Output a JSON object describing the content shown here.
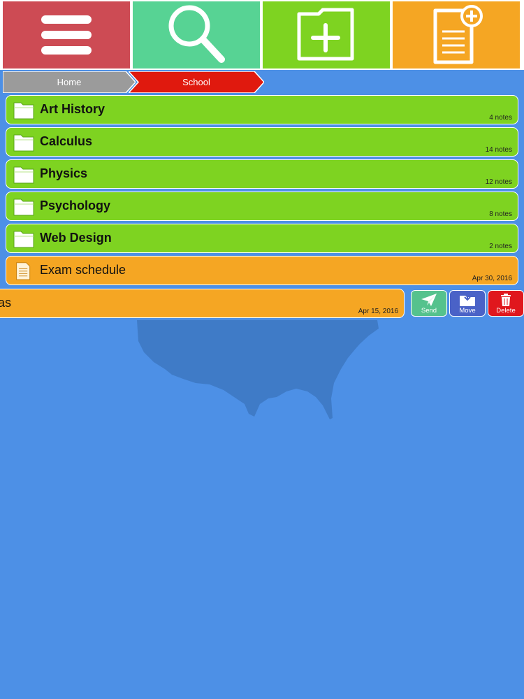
{
  "colors": {
    "background": "#4d90e6",
    "menu_button": "#cd4b54",
    "search_button": "#57d394",
    "new_folder_button": "#7ed321",
    "new_note_button": "#f5a623",
    "breadcrumb_home": "#9b9b9b",
    "breadcrumb_current": "#e0190e",
    "folder_row": "#7ed321",
    "note_row": "#f5a623",
    "send": "#55c28d",
    "move": "#4a62c7",
    "delete": "#e0171d"
  },
  "toolbar": {
    "menu_icon": "hamburger-icon",
    "search_icon": "magnifier-icon",
    "new_folder_icon": "folder-plus-icon",
    "new_note_icon": "note-plus-icon"
  },
  "breadcrumb": {
    "items": [
      {
        "label": "Home"
      },
      {
        "label": "School"
      }
    ]
  },
  "folders": [
    {
      "title": "Art History",
      "count": "4 notes"
    },
    {
      "title": "Calculus",
      "count": "14 notes"
    },
    {
      "title": "Physics",
      "count": "12 notes"
    },
    {
      "title": "Psychology",
      "count": "8 notes"
    },
    {
      "title": "Web Design",
      "count": "2 notes"
    }
  ],
  "notes": [
    {
      "title": "Exam schedule",
      "date": "Apr 30, 2016"
    },
    {
      "title": "as",
      "date": "Apr 15, 2016"
    }
  ],
  "swipe_actions": {
    "send": "Send",
    "move": "Move",
    "delete": "Delete"
  }
}
